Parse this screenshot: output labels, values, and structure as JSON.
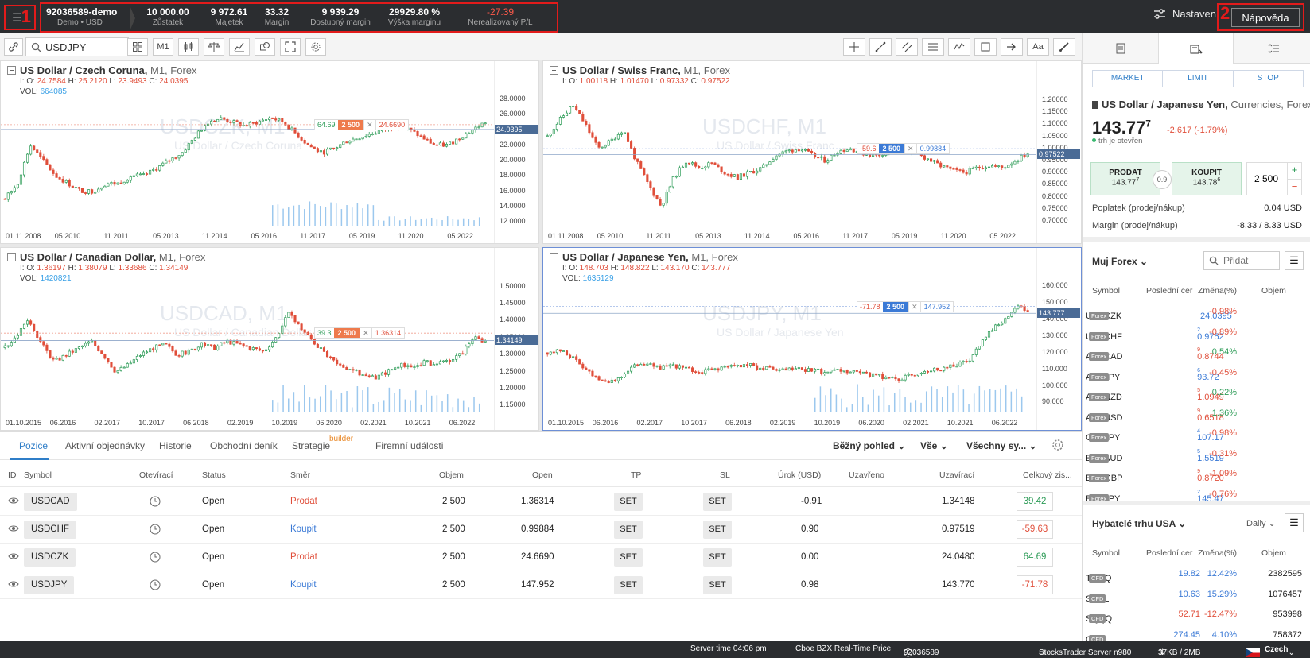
{
  "topbar": {
    "menu_num": "1",
    "help_num": "2",
    "account": {
      "id": "92036589-demo",
      "sub": "Demo • USD"
    },
    "stats": [
      {
        "value": "10 000.00",
        "label": "Zůstatek"
      },
      {
        "value": "9 972.61",
        "label": "Majetek"
      },
      {
        "value": "33.32",
        "label": "Margin"
      },
      {
        "value": "9 939.29",
        "label": "Dostupný margin"
      },
      {
        "value": "29929.80 %",
        "label": "Výška marginu"
      },
      {
        "value": "-27.39",
        "label": "Nerealizovaný P/L",
        "color": "#ff5a4a"
      }
    ],
    "settings_label": "Nastaven",
    "help_label": "Nápověda"
  },
  "toolbar": {
    "symbol": "USDJPY",
    "timeframe": "M1"
  },
  "charts": [
    {
      "title": "US Dollar / Czech Coruna,",
      "tf": "M1,",
      "cat": "Forex",
      "o": "24.7584",
      "h": "25.2120",
      "l": "23.9493",
      "c": "24.0395",
      "vol": "664085",
      "wm": "USDCZK, M1",
      "wm_sub": "US Dollar / Czech Coruna",
      "yticks": [
        "28.0000",
        "26.0000",
        "24.0000",
        "22.0000",
        "20.0000",
        "18.0000",
        "16.0000",
        "14.0000",
        "12.0000"
      ],
      "ymin": 11.5,
      "ymax": 28.8,
      "xticks": [
        "01.11.2008",
        "05.2010",
        "11.2011",
        "05.2013",
        "11.2014",
        "05.2016",
        "11.2017",
        "05.2019",
        "11.2020",
        "05.2022"
      ],
      "last": "24.0395",
      "last_val": 24.0395,
      "order": {
        "pl": "64.69",
        "qty": "2 500",
        "price": "24.6690",
        "price_val": 24.669,
        "side": "sell"
      },
      "seed": 7,
      "series": [
        15,
        17,
        22,
        20,
        18,
        17,
        16,
        16,
        17,
        17,
        18,
        18,
        19,
        20,
        21,
        23,
        25,
        25.5,
        25,
        24.5,
        25,
        25.6,
        25,
        23.5,
        22,
        21,
        21.5,
        22.5,
        23,
        23.5,
        24,
        24.5,
        24,
        23,
        22,
        22,
        23,
        24,
        25
      ]
    },
    {
      "title": "US Dollar / Swiss Franc,",
      "tf": "M1,",
      "cat": "Forex",
      "o": "1.00118",
      "h": "1.01470",
      "l": "0.97332",
      "c": "0.97522",
      "vol": "",
      "wm": "USDCHF, M1",
      "wm_sub": "US Dollar / Swiss Franc",
      "yticks": [
        "1.20000",
        "1.15000",
        "1.10000",
        "1.05000",
        "1.00000",
        "0.95000",
        "0.90000",
        "0.85000",
        "0.80000",
        "0.75000",
        "0.70000"
      ],
      "ymin": 0.68,
      "ymax": 1.23,
      "xticks": [
        "01.11.2008",
        "05.2010",
        "11.2011",
        "05.2013",
        "11.2014",
        "05.2016",
        "11.2017",
        "05.2019",
        "11.2020",
        "05.2022"
      ],
      "last": "0.97522",
      "last_val": 0.97522,
      "order": {
        "pl": "-59.6",
        "qty": "2 500",
        "price": "0.99884",
        "price_val": 0.99884,
        "side": "buy"
      },
      "seed": 11,
      "series": [
        1.05,
        1.12,
        1.18,
        1.1,
        1.0,
        1.03,
        1.08,
        0.95,
        0.85,
        0.76,
        0.88,
        0.95,
        0.92,
        0.94,
        0.9,
        0.88,
        0.9,
        0.92,
        0.97,
        0.99,
        1.0,
        0.97,
        0.95,
        0.99,
        1.0,
        0.98,
        0.97,
        0.99,
        1.0,
        0.98,
        0.96,
        0.93,
        0.91,
        0.9,
        0.92,
        0.93,
        0.92,
        0.95,
        0.98
      ]
    },
    {
      "title": "US Dollar / Canadian Dollar,",
      "tf": "M1,",
      "cat": "Forex",
      "o": "1.36197",
      "h": "1.38079",
      "l": "1.33686",
      "c": "1.34149",
      "vol": "1420821",
      "wm": "USDCAD, M1",
      "wm_sub": "US Dollar / Canadian Dollar",
      "yticks": [
        "1.50000",
        "1.45000",
        "1.40000",
        "1.35000",
        "1.30000",
        "1.25000",
        "1.20000",
        "1.15000"
      ],
      "ymin": 1.13,
      "ymax": 1.52,
      "xticks": [
        "01.10.2015",
        "06.2016",
        "02.2017",
        "10.2017",
        "06.2018",
        "02.2019",
        "10.2019",
        "06.2020",
        "02.2021",
        "10.2021",
        "06.2022"
      ],
      "last": "1.34149",
      "last_val": 1.34149,
      "order": {
        "pl": "39.3",
        "qty": "2 500",
        "price": "1.36314",
        "price_val": 1.36314,
        "side": "sell"
      },
      "seed": 3,
      "series": [
        1.32,
        1.36,
        1.4,
        1.33,
        1.28,
        1.3,
        1.32,
        1.34,
        1.3,
        1.25,
        1.27,
        1.3,
        1.32,
        1.33,
        1.3,
        1.31,
        1.33,
        1.32,
        1.34,
        1.33,
        1.32,
        1.31,
        1.35,
        1.42,
        1.38,
        1.34,
        1.3,
        1.27,
        1.26,
        1.24,
        1.23,
        1.25,
        1.27,
        1.26,
        1.28,
        1.27,
        1.28,
        1.3,
        1.35,
        1.34
      ]
    },
    {
      "title": "US Dollar / Japanese Yen,",
      "tf": "M1,",
      "cat": "Forex",
      "o": "148.703",
      "h": "148.822",
      "l": "143.170",
      "c": "143.777",
      "vol": "1635129",
      "wm": "USDJPY, M1",
      "wm_sub": "US Dollar / Japanese Yen",
      "yticks": [
        "160.000",
        "150.000",
        "140.000",
        "130.000",
        "120.000",
        "110.000",
        "100.000",
        "90.000"
      ],
      "ymin": 84,
      "ymax": 164,
      "xticks": [
        "01.10.2015",
        "06.2016",
        "02.2017",
        "10.2017",
        "06.2018",
        "02.2019",
        "10.2019",
        "06.2020",
        "02.2021",
        "10.2021",
        "06.2022"
      ],
      "last": "143.777",
      "last_val": 143.777,
      "order": {
        "pl": "-71.78",
        "qty": "2 500",
        "price": "147.952",
        "price_val": 147.952,
        "side": "buy"
      },
      "seed": 5,
      "series": [
        120,
        121,
        118,
        112,
        106,
        103,
        104,
        110,
        114,
        112,
        111,
        112,
        110,
        108,
        110,
        111,
        112,
        113,
        111,
        110,
        109,
        110,
        110,
        109,
        108,
        109,
        108,
        107,
        106,
        105,
        104,
        106,
        109,
        110,
        111,
        113,
        115,
        125,
        135,
        140,
        148,
        145
      ]
    }
  ],
  "bottom": {
    "tabs": [
      "Pozice",
      "Aktivní objednávky",
      "Historie",
      "Obchodní deník",
      "Strategie",
      "Firemní události"
    ],
    "builder": "builder",
    "view": "Běžný pohled",
    "filter": "Vše",
    "symbols": "Všechny sy...",
    "headers": [
      "ID",
      "Symbol",
      "Otevírací",
      "Status",
      "Směr",
      "Objem",
      "Open",
      "TP",
      "SL",
      "Úrok (USD)",
      "Uzavřeno",
      "Uzavírací",
      "Celkový zis..."
    ],
    "rows": [
      {
        "symbol": "USDCAD",
        "status": "Open",
        "dir": "Prodat",
        "vol": "2 500",
        "open": "1.36314",
        "tp": "SET",
        "sl": "SET",
        "interest": "-0.91",
        "close": "1.34148",
        "pl": "39.42",
        "pos": true
      },
      {
        "symbol": "USDCHF",
        "status": "Open",
        "dir": "Koupit",
        "vol": "2 500",
        "open": "0.99884",
        "tp": "SET",
        "sl": "SET",
        "interest": "0.90",
        "close": "0.97519",
        "pl": "-59.63",
        "pos": false
      },
      {
        "symbol": "USDCZK",
        "status": "Open",
        "dir": "Prodat",
        "vol": "2 500",
        "open": "24.6690",
        "tp": "SET",
        "sl": "SET",
        "interest": "0.00",
        "close": "24.0480",
        "pl": "64.69",
        "pos": true
      },
      {
        "symbol": "USDJPY",
        "status": "Open",
        "dir": "Koupit",
        "vol": "2 500",
        "open": "147.952",
        "tp": "SET",
        "sl": "SET",
        "interest": "0.98",
        "close": "143.770",
        "pl": "-71.78",
        "pos": false
      }
    ]
  },
  "panel": {
    "order_types": [
      "MARKET",
      "LIMIT",
      "STOP"
    ],
    "inst_name": "US Dollar / Japanese Yen,",
    "inst_cat": "Currencies, Forex",
    "price_main": "143.77",
    "price_sup": "7",
    "change": "-2.617 (-1.79%)",
    "status": "trh je otevřen",
    "sell_label": "PRODAT",
    "sell_main": "143.77",
    "sell_sup": "7",
    "buy_label": "KOUPIT",
    "buy_main": "143.78",
    "buy_sup": "6",
    "spread": "0.9",
    "qty": "2 500",
    "fee_label": "Poplatek (prodej/nákup)",
    "fee_value": "0.04 USD",
    "margin_label": "Margin (prodej/nákup)",
    "margin_value": "-8.33 / 8.33 USD",
    "watch_title": "Muj Forex",
    "add_placeholder": "Přidat",
    "wl_headers": [
      "Symbol",
      "Poslední cer",
      "Změna(%)",
      "Objem"
    ],
    "watch": [
      {
        "sym": "USDCZK",
        "badge": "Forex",
        "main": "24.0395",
        "sup": "",
        "chg": "-0.98%",
        "up": false,
        "pc": "#3b7ad6"
      },
      {
        "sym": "USDCHF",
        "badge": "Forex",
        "main": "0.9752",
        "sup": "2",
        "chg": "-0.89%",
        "up": false,
        "pc": "#3b7ad6"
      },
      {
        "sym": "AUDCAD",
        "badge": "Forex",
        "main": "0.8744",
        "sup": "9",
        "chg": "0.54%",
        "up": true,
        "pc": "#e04e3a"
      },
      {
        "sym": "AUDJPY",
        "badge": "Forex",
        "main": "93.72",
        "sup": "6",
        "chg": "-0.45%",
        "up": false,
        "pc": "#3b7ad6"
      },
      {
        "sym": "AUDNZD",
        "badge": "Forex",
        "main": "1.0949",
        "sup": "5",
        "chg": "0.22%",
        "up": true,
        "pc": "#e04e3a"
      },
      {
        "sym": "AUDUSD",
        "badge": "Forex",
        "main": "0.6518",
        "sup": "9",
        "chg": "1.36%",
        "up": true,
        "pc": "#e04e3a"
      },
      {
        "sym": "CADJPY",
        "badge": "Forex",
        "main": "107.17",
        "sup": "4",
        "chg": "-0.98%",
        "up": false,
        "pc": "#3b7ad6"
      },
      {
        "sym": "EURAUD",
        "badge": "Forex",
        "main": "1.5519",
        "sup": "5",
        "chg": "-0.31%",
        "up": false,
        "pc": "#3b7ad6"
      },
      {
        "sym": "EURGBP",
        "badge": "Forex",
        "main": "0.8720",
        "sup": "9",
        "chg": "-1.09%",
        "up": false,
        "pc": "#e04e3a"
      },
      {
        "sym": "EURJPY",
        "badge": "Forex",
        "main": "145.47",
        "sup": "2",
        "chg": "-0.76%",
        "up": false,
        "pc": "#3b7ad6"
      }
    ],
    "movers_title": "Hybatelé trhu USA",
    "movers_period": "Daily",
    "movers": [
      {
        "sym": "TQQQ",
        "badge": "CFD",
        "last": "19.82",
        "chg": "12.42%",
        "vol": "2382595",
        "up": true
      },
      {
        "sym": "SOXL",
        "badge": "CFD",
        "last": "10.63",
        "chg": "15.29%",
        "vol": "1076457",
        "up": true
      },
      {
        "sym": "SQQQ",
        "badge": "CFD",
        "last": "52.71",
        "chg": "-12.47%",
        "vol": "953998",
        "up": false
      },
      {
        "sym": "QQQ",
        "badge": "CFD",
        "last": "274.45",
        "chg": "4.10%",
        "vol": "758372",
        "up": true
      }
    ]
  },
  "statusbar": {
    "time": "Server time 04:06 pm",
    "feed": "Cboe BZX Real-Time Price",
    "user": "92036589",
    "server": "StocksTrader Server n980",
    "traffic": "37KB / 2MB",
    "lang": "Czech"
  },
  "colors": {
    "up": "#2e9c58",
    "down": "#e04e3a",
    "accent": "#2f7ec8",
    "blue": "#3b7ad6"
  }
}
